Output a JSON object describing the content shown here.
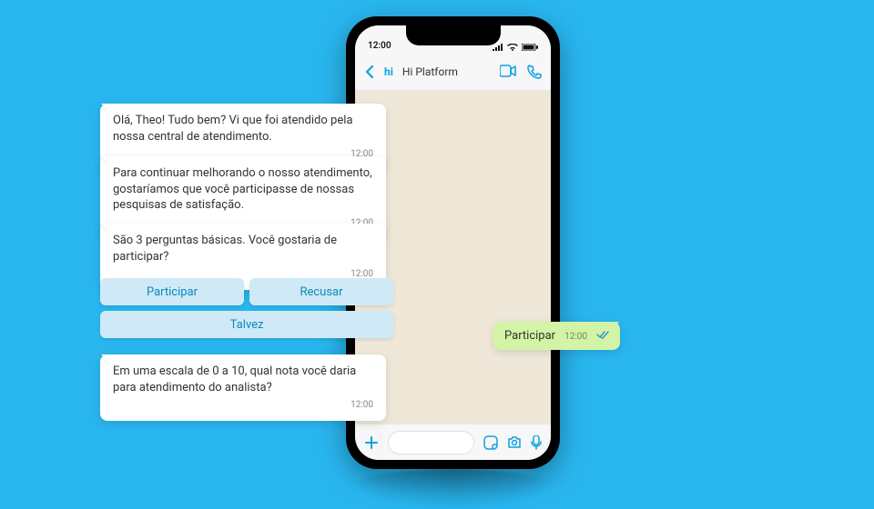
{
  "status": {
    "time": "12:00"
  },
  "header": {
    "logo": "hi",
    "title": "Hi Platform"
  },
  "messages": {
    "m1": {
      "text": "Olá, Theo! Tudo bem? Vi que foi atendido pela nossa central de atendimento.",
      "time": "12:00"
    },
    "m2": {
      "text": "Para continuar melhorando o nosso atendimento, gostaríamos que você participasse de nossas pesquisas de satisfação.",
      "time": "12:00"
    },
    "m3": {
      "text": "São 3 perguntas básicas. Você gostaria de participar?",
      "time": "12:00"
    },
    "m4": {
      "text": "Em uma escala de 0 a 10, qual nota você daria para atendimento do analista?",
      "time": "12:00"
    }
  },
  "options": {
    "opt1": "Participar",
    "opt2": "Recusar",
    "opt3": "Talvez"
  },
  "reply": {
    "text": "Participar",
    "time": "12:00"
  }
}
